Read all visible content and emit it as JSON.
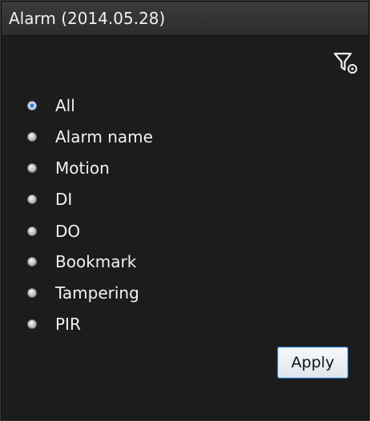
{
  "panel": {
    "title": "Alarm (2014.05.28)"
  },
  "filter": {
    "icon": "filter-settings-icon"
  },
  "event_types": {
    "selected": "All",
    "options": [
      {
        "label": "All",
        "checked": true
      },
      {
        "label": "Alarm name",
        "checked": false
      },
      {
        "label": "Motion",
        "checked": false
      },
      {
        "label": "DI",
        "checked": false
      },
      {
        "label": "DO",
        "checked": false
      },
      {
        "label": "Bookmark",
        "checked": false
      },
      {
        "label": "Tampering",
        "checked": false
      },
      {
        "label": "PIR",
        "checked": false
      }
    ]
  },
  "actions": {
    "apply_label": "Apply"
  },
  "colors": {
    "background": "#1c1c1c",
    "titlebar": "#333333",
    "text": "#f2f2f2",
    "selected_radio": "#2f7fd8",
    "button_border": "#2a6fbf"
  }
}
